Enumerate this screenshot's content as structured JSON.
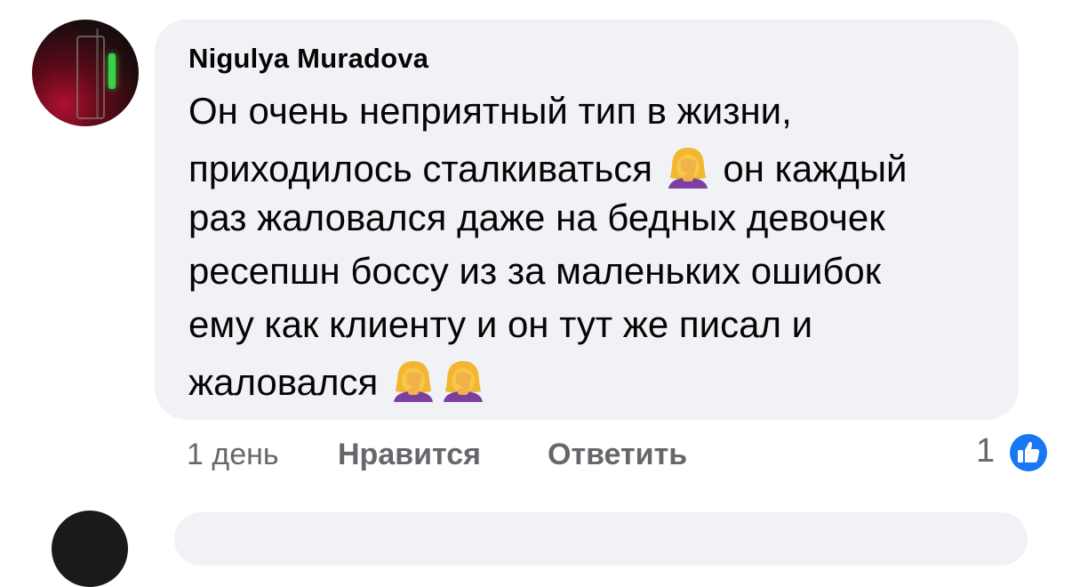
{
  "comment": {
    "author": "Nigulya Muradova",
    "lines": [
      "Он очень неприятный тип в жизни,",
      "приходилось сталкиваться",
      "он каждый",
      "раз жаловался даже на бедных девочек",
      "ресепшн боссу из за маленьких ошибок",
      "ему как клиенту и он тут же писал и",
      "жаловался"
    ],
    "emojis": [
      "woman-facepalming-icon",
      "woman-facepalming-icon",
      "woman-facepalming-icon"
    ]
  },
  "actions": {
    "time": "1 день",
    "like_label": "Нравится",
    "reply_label": "Ответить"
  },
  "reactions": {
    "count": "1",
    "icon": "like-icon",
    "color": "#1877f2"
  }
}
